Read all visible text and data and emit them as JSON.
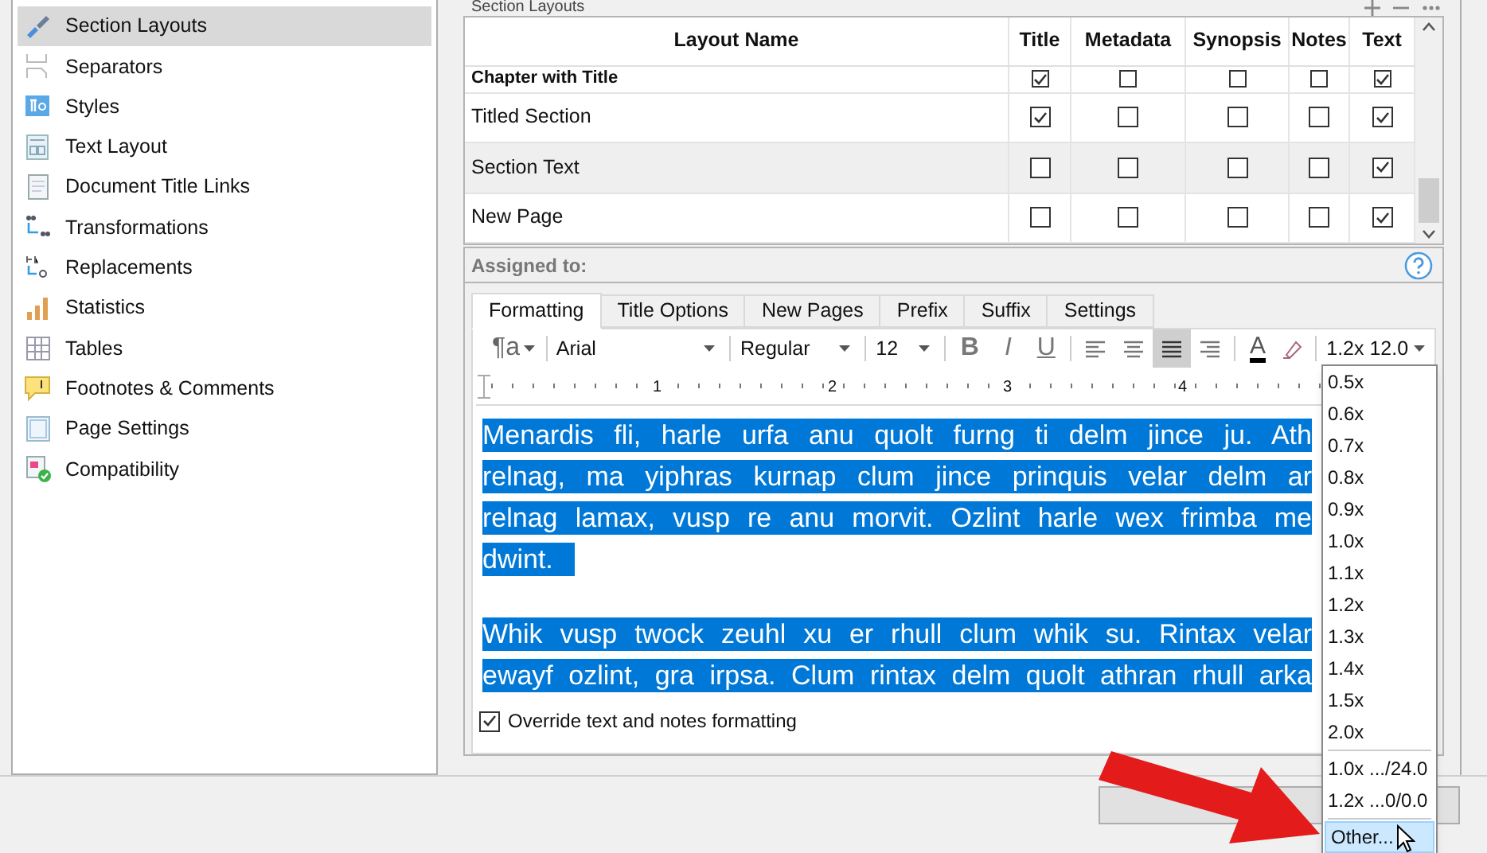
{
  "sidebar": {
    "items": [
      {
        "label": "Section Layouts",
        "selected": true
      },
      {
        "label": "Separators",
        "selected": false
      },
      {
        "label": "Styles",
        "selected": false
      },
      {
        "label": "Text Layout",
        "selected": false
      },
      {
        "label": "Document Title Links",
        "selected": false
      },
      {
        "label": "Transformations",
        "selected": false
      },
      {
        "label": "Replacements",
        "selected": false
      },
      {
        "label": "Statistics",
        "selected": false
      },
      {
        "label": "Tables",
        "selected": false
      },
      {
        "label": "Footnotes & Comments",
        "selected": false
      },
      {
        "label": "Page Settings",
        "selected": false
      },
      {
        "label": "Compatibility",
        "selected": false
      }
    ]
  },
  "section_layouts": {
    "title": "Section Layouts",
    "table": {
      "columns": [
        "Layout Name",
        "Title",
        "Metadata",
        "Synopsis",
        "Notes",
        "Text"
      ],
      "rows": [
        {
          "name": "Chapter with Title",
          "bold": true,
          "selected": false,
          "checks": [
            true,
            false,
            false,
            false,
            true
          ]
        },
        {
          "name": "Titled Section",
          "bold": false,
          "selected": false,
          "checks": [
            true,
            false,
            false,
            false,
            true
          ]
        },
        {
          "name": "Section Text",
          "bold": false,
          "selected": true,
          "checks": [
            false,
            false,
            false,
            false,
            true
          ]
        },
        {
          "name": "New Page",
          "bold": false,
          "selected": false,
          "checks": [
            false,
            false,
            false,
            false,
            true
          ]
        }
      ]
    }
  },
  "assigned_to": {
    "label": "Assigned to:"
  },
  "tabs": [
    {
      "label": "Formatting",
      "selected": true
    },
    {
      "label": "Title Options",
      "selected": false
    },
    {
      "label": "New Pages",
      "selected": false
    },
    {
      "label": "Prefix",
      "selected": false
    },
    {
      "label": "Suffix",
      "selected": false
    },
    {
      "label": "Settings",
      "selected": false
    }
  ],
  "toolbar": {
    "style_button": "¶a",
    "font": "Arial",
    "weight": "Regular",
    "size": "12",
    "format_buttons": [
      {
        "label": "B",
        "kind": "bold"
      },
      {
        "label": "I",
        "kind": "italic"
      },
      {
        "label": "U",
        "kind": "underline"
      }
    ],
    "align_buttons": [
      {
        "kind": "left",
        "selected": false
      },
      {
        "kind": "center",
        "selected": false
      },
      {
        "kind": "justify",
        "selected": true
      },
      {
        "kind": "right",
        "selected": false
      }
    ],
    "font_color": "A",
    "line_spacing": "1.2x 12.0"
  },
  "ruler": {
    "numbers": [
      "1",
      "2",
      "3",
      "4"
    ]
  },
  "sample_text": {
    "paragraphs": [
      {
        "lines": [
          "Menardis fli, harle urfa anu quolt furng ti delm jince ju. Ath",
          "relnag, ma yiphras kurnap clum jince prinquis velar delm ar",
          "relnag lamax, vusp re anu morvit. Ozlint harle wex frimba me",
          "dwint."
        ]
      },
      {
        "lines": [
          "Whik vusp twock zeuhl xu er rhull clum whik su. Rintax velar",
          "ewayf ozlint, gra irpsa. Clum rintax delm quolt athran rhull arka"
        ]
      }
    ]
  },
  "override": {
    "label": "Override text and notes formatting",
    "checked": true
  },
  "spacing_menu": {
    "groups": [
      [
        {
          "label": "0.5x",
          "selected": false
        },
        {
          "label": "0.6x",
          "selected": false
        },
        {
          "label": "0.7x",
          "selected": false
        },
        {
          "label": "0.8x",
          "selected": false
        },
        {
          "label": "0.9x",
          "selected": false
        },
        {
          "label": "1.0x",
          "selected": false
        },
        {
          "label": "1.1x",
          "selected": false
        },
        {
          "label": "1.2x",
          "selected": false
        },
        {
          "label": "1.3x",
          "selected": false
        },
        {
          "label": "1.4x",
          "selected": false
        },
        {
          "label": "1.5x",
          "selected": false
        },
        {
          "label": "2.0x",
          "selected": false
        }
      ],
      [
        {
          "label": "1.0x .../24.0",
          "selected": false
        },
        {
          "label": "1.2x ...0/0.0",
          "selected": false
        }
      ],
      [
        {
          "label": "Other...",
          "selected": true
        }
      ]
    ]
  }
}
